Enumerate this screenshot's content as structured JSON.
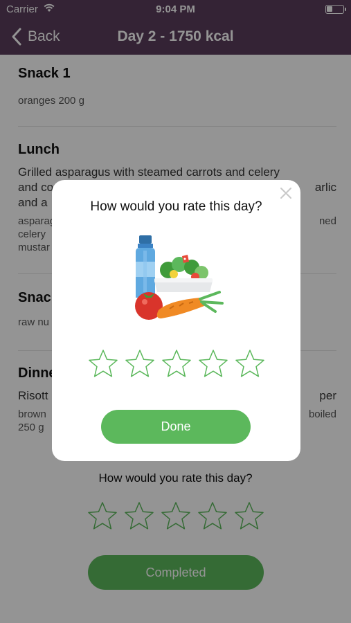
{
  "status_bar": {
    "carrier": "Carrier",
    "time": "9:04 PM"
  },
  "nav": {
    "back_label": "Back",
    "title": "Day 2 - 1750 kcal"
  },
  "meals": [
    {
      "title": "Snack 1",
      "description": "",
      "details": "oranges 200 g"
    },
    {
      "title": "Lunch",
      "description": "Grilled asparagus with steamed carrots and celery and co… …arlic and a…",
      "details": "asparag… …ned celery … mustar…"
    },
    {
      "title": "Snac…",
      "description": "",
      "details": "raw nu…"
    },
    {
      "title": "Dinne…",
      "description": "Risott… …per",
      "details": "brown… …boiled 250 g"
    }
  ],
  "lunch_lines": {
    "desc_1": "Grilled asparagus with steamed carrots and celery",
    "desc_2_left": "and co",
    "desc_2_right": "arlic",
    "desc_3_left": "and a",
    "detail_1_left": "asparag",
    "detail_1_right": "ned",
    "detail_2_left": "celery",
    "detail_3_left": "mustar"
  },
  "snack2_lines": {
    "title": "Snac",
    "detail": "raw nu"
  },
  "dinner_lines": {
    "title": "Dinne",
    "desc_left": "Risott",
    "desc_right": "per",
    "detail_1_left": "brown",
    "detail_1_right": "boiled",
    "detail_2_left": "250 g"
  },
  "page_rating": {
    "question": "How would you rate this day?",
    "stars": 5,
    "rating": 0,
    "button_label": "Completed"
  },
  "modal": {
    "question": "How would you rate this day?",
    "illustration_icon": "healthy-food-icon",
    "stars": 5,
    "rating": 0,
    "button_label": "Done"
  },
  "colors": {
    "nav_bar": "#5a3d5c",
    "accent_green": "#5cb85c",
    "star_outline": "#5cb85c"
  }
}
